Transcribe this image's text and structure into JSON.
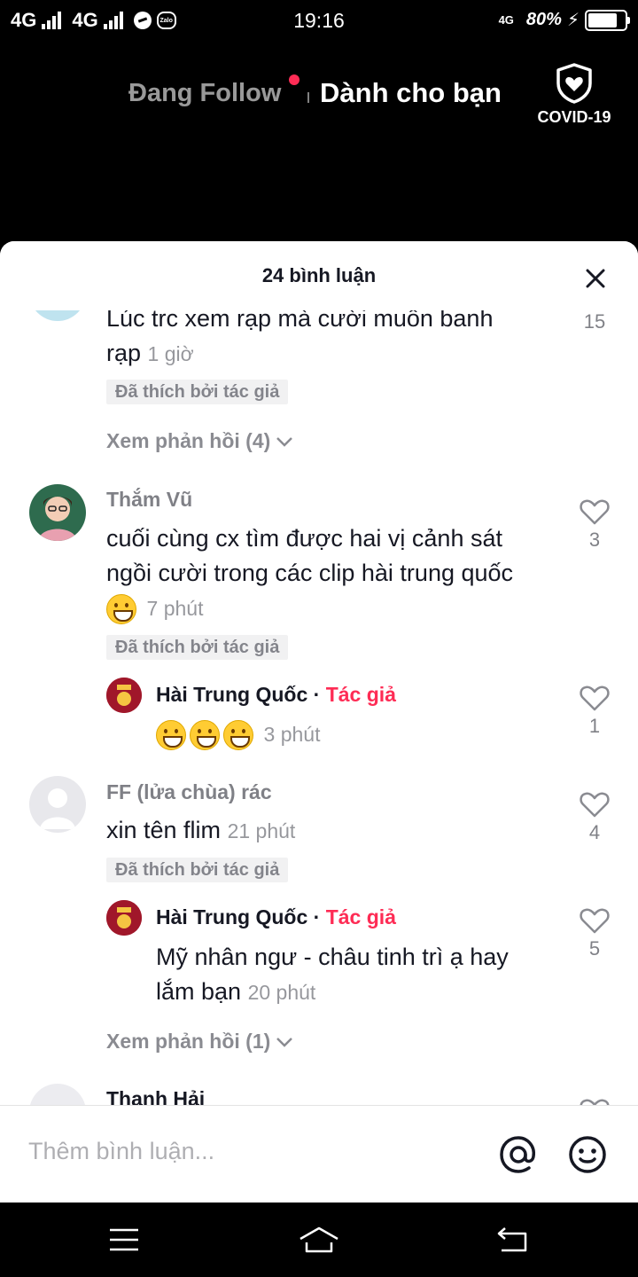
{
  "status_bar": {
    "net1": "4G",
    "net2": "4G",
    "time": "19:16",
    "net_right": "4G",
    "battery": "80%",
    "battery_level": 0.8
  },
  "top_nav": {
    "following": "Đang Follow",
    "for_you": "Dành cho bạn",
    "covid": "COVID-19"
  },
  "comments_panel": {
    "title": "24 bình luận",
    "comments": [
      {
        "text": "Lúc trc xem rạp mà cười muốn banh rạp",
        "time": "1 giờ",
        "likes": "15",
        "badge": "Đã thích bởi tác giả",
        "view_replies": "Xem phản hồi (4)"
      },
      {
        "username": "Thắm Vũ",
        "text": "cuối cùng cx tìm được hai vị cảnh sát ngồi cười trong các clip hài trung quốc",
        "time": "7 phút",
        "likes": "3",
        "badge": "Đã thích bởi tác giả",
        "reply": {
          "username": "Hài Trung Quốc",
          "dot": " · ",
          "author_tag": "Tác giả",
          "time": "3 phút",
          "likes": "1"
        }
      },
      {
        "username": "FF (lửa chùa) rác",
        "text": "xin tên flim",
        "time": "21 phút",
        "likes": "4",
        "badge": "Đã thích bởi tác giả",
        "reply": {
          "username": "Hài Trung Quốc",
          "dot": " · ",
          "author_tag": "Tác giả",
          "text": "Mỹ nhân ngư - châu tinh trì ạ hay lắm bạn",
          "time": "20 phút",
          "likes": "5"
        },
        "view_replies": "Xem phản hồi (1)"
      },
      {
        "username": "Thanh Hải"
      }
    ]
  },
  "input": {
    "placeholder": "Thêm bình luận..."
  },
  "colors": {
    "accent": "#fe2c55",
    "muted_text": "#8a8b91",
    "badge_bg": "#f1f1f2"
  }
}
